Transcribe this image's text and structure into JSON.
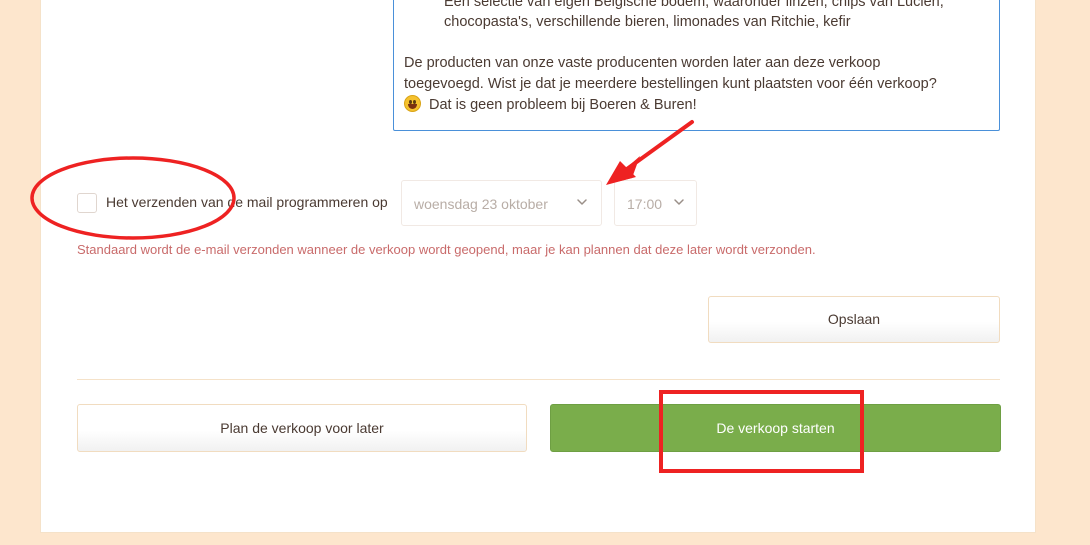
{
  "description_box": {
    "lines_indented": [
      "Een selectie van eigen Belgische bodem, waaronder linzen, chips van Lucien,",
      "chocopasta's, verschillende bieren, limonades van Ritchie, kefir"
    ],
    "lines_body": [
      "De producten van onze vaste producenten worden later aan deze verkoop",
      "toegevoegd. Wist je dat je meerdere bestellingen kunt plaatsten voor één verkoop?"
    ],
    "last_line": "Dat is geen probleem bij Boeren & Buren!",
    "emoji_icon": "grinning-face-emoji"
  },
  "schedule": {
    "checkbox_label": "Het verzenden van de mail programmeren op",
    "date_value": "woensdag 23 oktober",
    "time_value": "17:00",
    "hint": "Standaard wordt de e-mail verzonden wanneer de verkoop wordt geopend, maar je kan plannen dat deze later wordt verzonden."
  },
  "buttons": {
    "save_label": "Opslaan",
    "plan_label": "Plan de verkoop voor later",
    "start_label": "De verkoop starten"
  },
  "colors": {
    "page_background": "#fde6cd",
    "primary_green": "#7aad4b",
    "hint_text": "#c96b6b",
    "textarea_focus_border": "#4a90d9",
    "annotation_red": "#ee2222"
  }
}
